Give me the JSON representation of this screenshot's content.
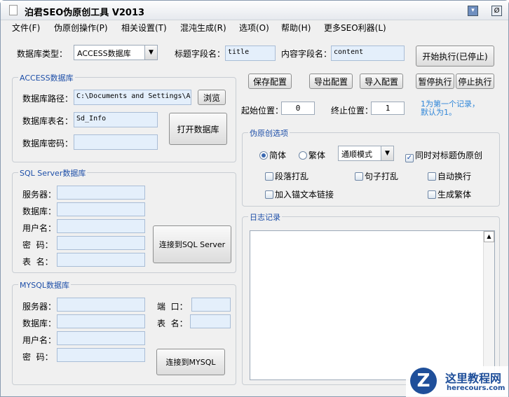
{
  "window": {
    "title": "泊君SEO伪原创工具 V2013"
  },
  "menu": [
    "文件(F)",
    "伪原创操作(P)",
    "相关设置(T)",
    "混沌生成(R)",
    "选项(O)",
    "帮助(H)",
    "更多SEO利器(L)"
  ],
  "top": {
    "db_type_label": "数据库类型：",
    "db_type_value": "ACCESS数据库",
    "title_field_label": "标题字段名：",
    "title_field_value": "title",
    "content_field_label": "内容字段名：",
    "content_field_value": "content",
    "start_button": "开始执行(已停止)"
  },
  "access": {
    "legend": "ACCESS数据库",
    "path_label": "数据库路径：",
    "path_value": "C:\\Documents and Settings\\Ad",
    "browse": "浏览",
    "table_label": "数据库表名：",
    "table_value": "Sd_Info",
    "password_label": "数据库密码：",
    "open_button": "打开数据库"
  },
  "sql": {
    "legend": "SQL Server数据库",
    "server": "服务器：",
    "database": "数据库：",
    "user": "用户名：",
    "password": "密  码：",
    "table": "表  名：",
    "connect": "连接到SQL Server"
  },
  "mysql": {
    "legend": "MYSQL数据库",
    "server": "服务器：",
    "database": "数据库：",
    "user": "用户名：",
    "password": "密  码：",
    "port": "端  口：",
    "table": "表  名：",
    "connect": "连接到MYSQL"
  },
  "config": {
    "save": "保存配置",
    "export": "导出配置",
    "import": "导入配置",
    "pause": "暂停执行",
    "stop": "停止执行"
  },
  "range": {
    "start_label": "起始位置：",
    "start_value": "0",
    "end_label": "终止位置：",
    "end_value": "1",
    "hint1": "1为第一个记录，",
    "hint2": "默认为1。"
  },
  "options": {
    "legend": "伪原创选项",
    "simplified": "简体",
    "traditional": "繁体",
    "mode": "通顺模式",
    "title_too": "同时对标题伪原创",
    "shuffle_para": "段落打乱",
    "shuffle_sentence": "句子打乱",
    "auto_wrap": "自动换行",
    "anchor": "加入锚文本链接",
    "gen_trad": "生成繁体"
  },
  "log": {
    "legend": "日志记录"
  },
  "watermark": {
    "name": "这里教程网",
    "url": "herecours.com"
  }
}
